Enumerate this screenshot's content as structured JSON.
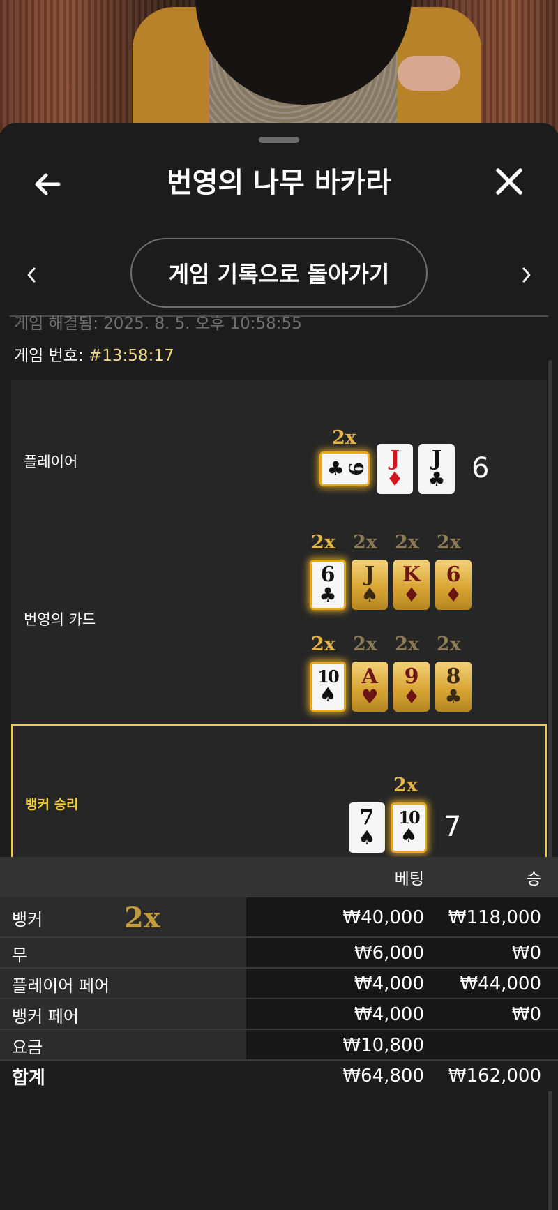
{
  "header": {
    "title": "번영의 나무 바카라",
    "back_label": "게임 기록으로 돌아가기"
  },
  "meta": {
    "resolved_label": "게임 해결됨: 2025. 8. 5. 오후 10:58:55",
    "game_number_label": "게임 번호:",
    "game_number_value": "#13:58:17"
  },
  "player_row": {
    "label": "플레이어",
    "score": "6",
    "cards": [
      {
        "rank": "9",
        "suit": "♣",
        "multiplier": "2x",
        "boosted": true,
        "sideways": true
      },
      {
        "rank": "J",
        "suit": "♦",
        "multiplier": "",
        "boosted": false
      },
      {
        "rank": "J",
        "suit": "♣",
        "multiplier": "",
        "boosted": false
      }
    ]
  },
  "prosperity_row": {
    "label": "번영의 카드",
    "top_cards": [
      {
        "rank": "6",
        "suit": "♣",
        "multiplier": "2x",
        "active": true
      },
      {
        "rank": "J",
        "suit": "♠",
        "multiplier": "2x",
        "active": false
      },
      {
        "rank": "K",
        "suit": "♦",
        "multiplier": "2x",
        "active": false
      },
      {
        "rank": "6",
        "suit": "♦",
        "multiplier": "2x",
        "active": false
      }
    ],
    "bottom_cards": [
      {
        "rank": "10",
        "suit": "♠",
        "multiplier": "2x",
        "active": true
      },
      {
        "rank": "A",
        "suit": "♥",
        "multiplier": "2x",
        "active": false
      },
      {
        "rank": "9",
        "suit": "♦",
        "multiplier": "2x",
        "active": false
      },
      {
        "rank": "8",
        "suit": "♣",
        "multiplier": "2x",
        "active": false
      }
    ]
  },
  "banker_row": {
    "label": "뱅커 승리",
    "score": "7",
    "cards": [
      {
        "rank": "7",
        "suit": "♠",
        "multiplier": "",
        "boosted": false
      },
      {
        "rank": "10",
        "suit": "♠",
        "multiplier": "2x",
        "boosted": true
      }
    ]
  },
  "bets_table": {
    "headers": {
      "bet": "베팅",
      "win": "승"
    },
    "rows": [
      {
        "label": "뱅커",
        "multiplier": "2x",
        "bet": "₩40,000",
        "win": "₩118,000"
      },
      {
        "label": "무",
        "multiplier": "",
        "bet": "₩6,000",
        "win": "₩0"
      },
      {
        "label": "플레이어 페어",
        "multiplier": "",
        "bet": "₩4,000",
        "win": "₩44,000"
      },
      {
        "label": "뱅커 페어",
        "multiplier": "",
        "bet": "₩4,000",
        "win": "₩0"
      },
      {
        "label": "요금",
        "multiplier": "",
        "bet": "₩10,800",
        "win": ""
      }
    ],
    "total": {
      "label": "합계",
      "bet": "₩64,800",
      "win": "₩162,000"
    }
  },
  "colors": {
    "accent_gold": "#e3b44a",
    "win_highlight": "#f2cf3a",
    "game_id": "#f0d888",
    "red_suit": "#d0161e"
  },
  "icons": {
    "back": "arrow-left-icon",
    "close": "close-icon",
    "prev": "chevron-left-icon",
    "next": "chevron-right-icon"
  }
}
